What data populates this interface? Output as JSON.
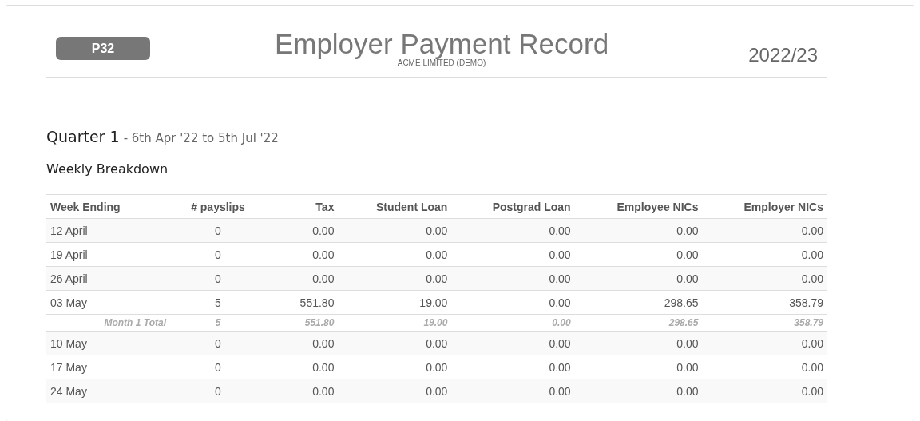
{
  "header": {
    "badge": "P32",
    "title": "Employer Payment Record",
    "company": "ACME LIMITED (DEMO)",
    "tax_year": "2022/23"
  },
  "quarter": {
    "title": "Quarter 1",
    "range": "- 6th Apr '22 to 5th Jul '22"
  },
  "section_title": "Weekly Breakdown",
  "table": {
    "columns": [
      "Week Ending",
      "# payslips",
      "Tax",
      "Student Loan",
      "Postgrad Loan",
      "Employee NICs",
      "Employer NICs"
    ],
    "rows": [
      {
        "kind": "week",
        "cells": [
          "12 April",
          "0",
          "0.00",
          "0.00",
          "0.00",
          "0.00",
          "0.00"
        ]
      },
      {
        "kind": "week",
        "cells": [
          "19 April",
          "0",
          "0.00",
          "0.00",
          "0.00",
          "0.00",
          "0.00"
        ]
      },
      {
        "kind": "week",
        "cells": [
          "26 April",
          "0",
          "0.00",
          "0.00",
          "0.00",
          "0.00",
          "0.00"
        ]
      },
      {
        "kind": "week",
        "cells": [
          "03 May",
          "5",
          "551.80",
          "19.00",
          "0.00",
          "298.65",
          "358.79"
        ]
      },
      {
        "kind": "total",
        "cells": [
          "Month 1 Total",
          "5",
          "551.80",
          "19.00",
          "0.00",
          "298.65",
          "358.79"
        ]
      },
      {
        "kind": "week",
        "cells": [
          "10 May",
          "0",
          "0.00",
          "0.00",
          "0.00",
          "0.00",
          "0.00"
        ]
      },
      {
        "kind": "week",
        "cells": [
          "17 May",
          "0",
          "0.00",
          "0.00",
          "0.00",
          "0.00",
          "0.00"
        ]
      },
      {
        "kind": "week",
        "cells": [
          "24 May",
          "0",
          "0.00",
          "0.00",
          "0.00",
          "0.00",
          "0.00"
        ]
      }
    ]
  }
}
